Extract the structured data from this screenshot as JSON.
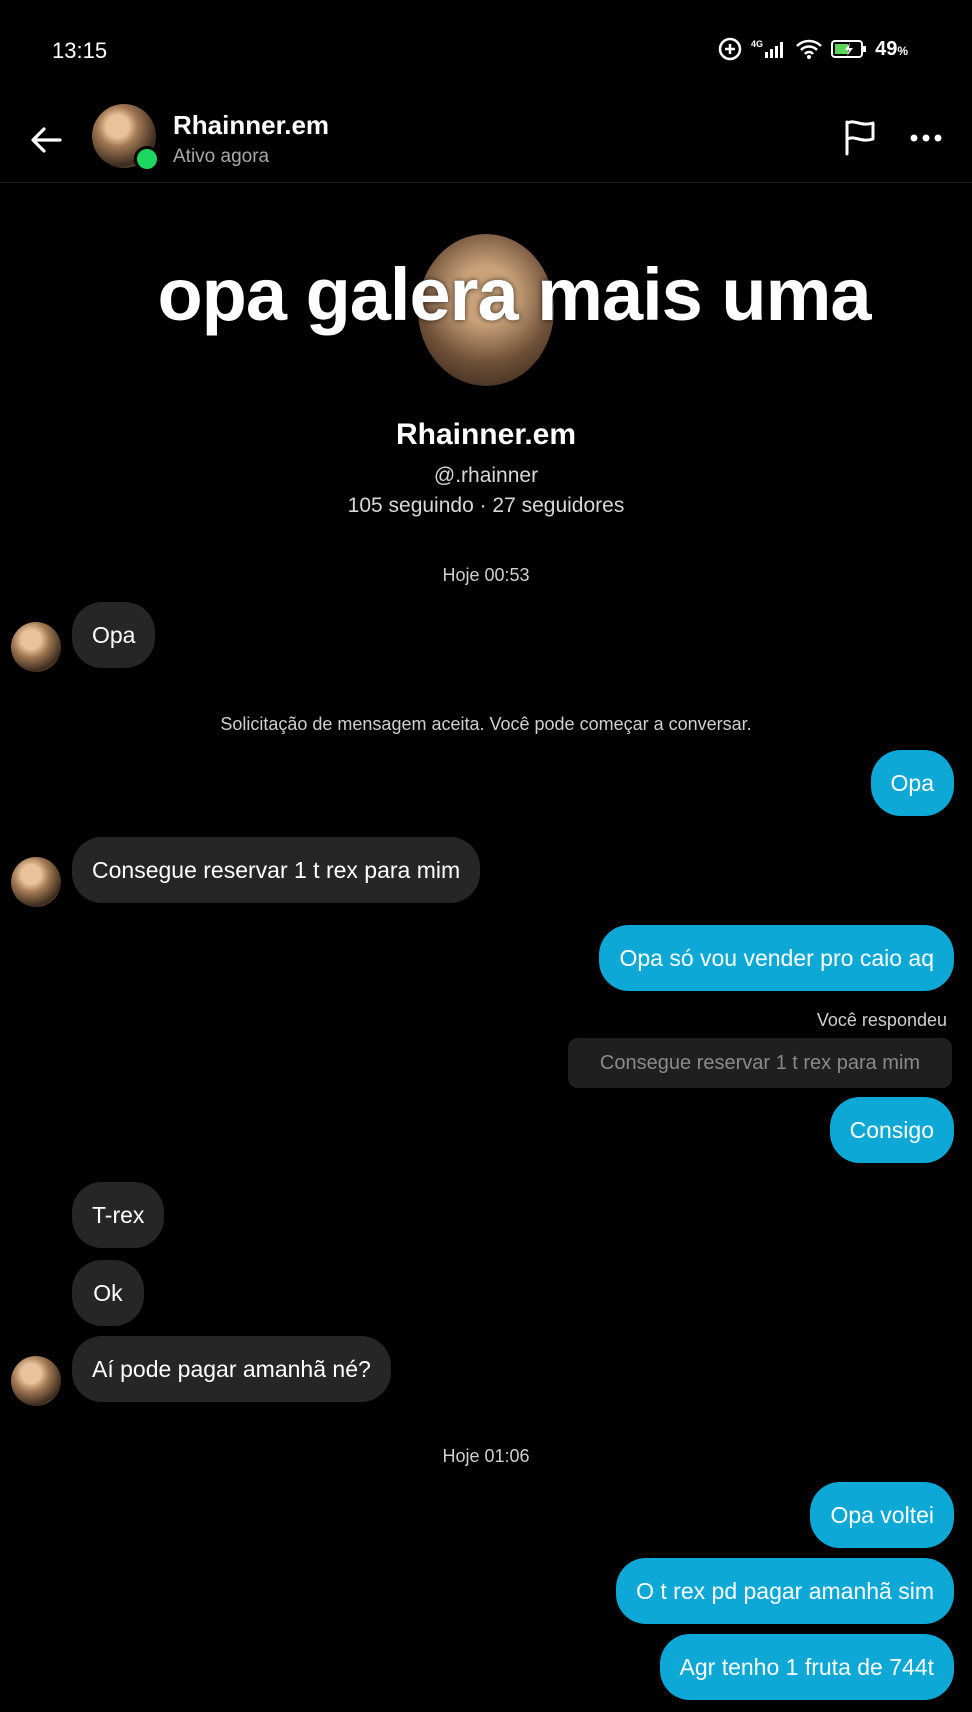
{
  "status_bar": {
    "time": "13:15",
    "network": "4G",
    "battery_percent": "49",
    "battery_unit": "%",
    "icons": [
      "data-saver-icon",
      "signal-icon",
      "wifi-icon",
      "battery-charging-icon"
    ]
  },
  "header": {
    "name": "Rhainner.em",
    "status": "Ativo agora",
    "online": true,
    "icons": [
      "back-arrow-icon",
      "flag-icon",
      "more-icon"
    ]
  },
  "profile": {
    "overlay_text": "opa galera mais uma",
    "name": "Rhainner.em",
    "handle": "@.rhainner",
    "stats": "105 seguindo · 27 seguidores"
  },
  "conversation": {
    "timestamp_1": "Hoje 00:53",
    "system_message": "Solicitação de mensagem aceita. Você pode começar a conversar.",
    "timestamp_2": "Hoje 01:06",
    "replied_label": "Você respondeu",
    "quoted_text": "Consegue reservar 1 t rex para mim",
    "messages": [
      {
        "sender": "them",
        "text": "Opa"
      },
      {
        "sender": "me",
        "text": "Opa"
      },
      {
        "sender": "them",
        "text": "Consegue reservar 1 t rex para mim"
      },
      {
        "sender": "me",
        "text": "Opa só vou vender pro caio aq"
      },
      {
        "sender": "me",
        "text": "Consigo"
      },
      {
        "sender": "them",
        "text": "T-rex"
      },
      {
        "sender": "them",
        "text": "Ok"
      },
      {
        "sender": "them",
        "text": "Aí pode pagar amanhã né?"
      },
      {
        "sender": "me",
        "text": "Opa voltei"
      },
      {
        "sender": "me",
        "text": "O t rex pd pagar amanhã sim"
      },
      {
        "sender": "me",
        "text": "Agr tenho 1 fruta de 744t"
      }
    ]
  },
  "colors": {
    "background": "#000000",
    "incoming_bubble": "#262626",
    "outgoing_bubble": "#0da8d6",
    "online_dot": "#1ed760"
  }
}
